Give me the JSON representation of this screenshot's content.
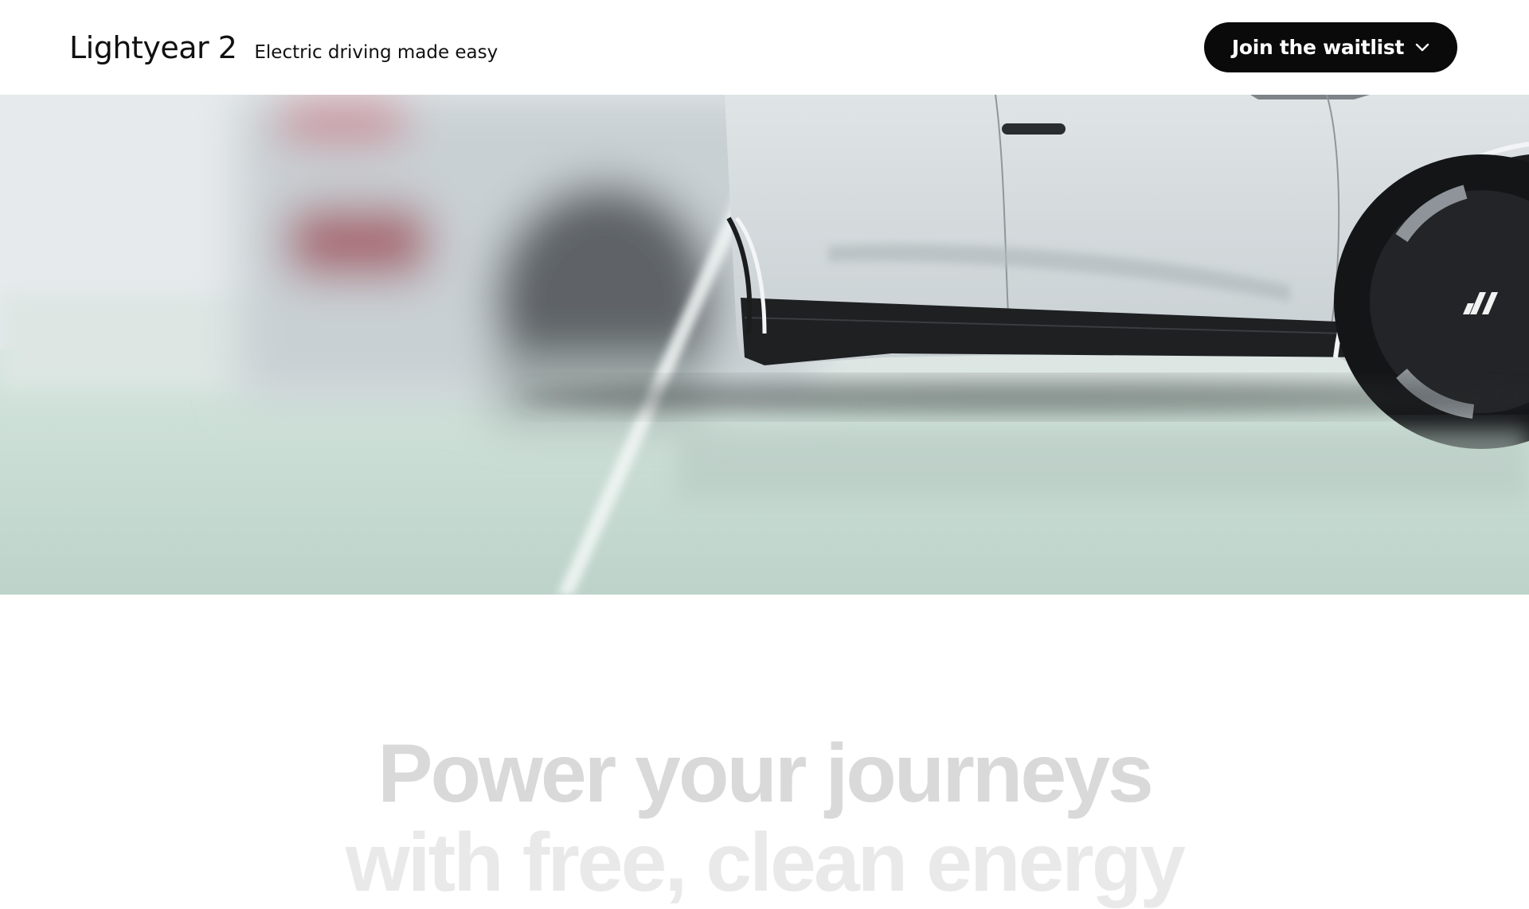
{
  "header": {
    "brand_name": "Lightyear 2",
    "tagline": "Electric driving made easy",
    "cta_label": "Join the waitlist",
    "cta_icon": "chevron-down-icon"
  },
  "hero": {
    "image_description_icon": "car-photo"
  },
  "headline": {
    "line1": "Power your journeys",
    "line2": "with free, clean energy"
  },
  "colors": {
    "cta_background": "#0a0a0a",
    "cta_text": "#ffffff",
    "headline_faded": "#d9d9d9",
    "hero_floor": "#c4d8d0"
  }
}
